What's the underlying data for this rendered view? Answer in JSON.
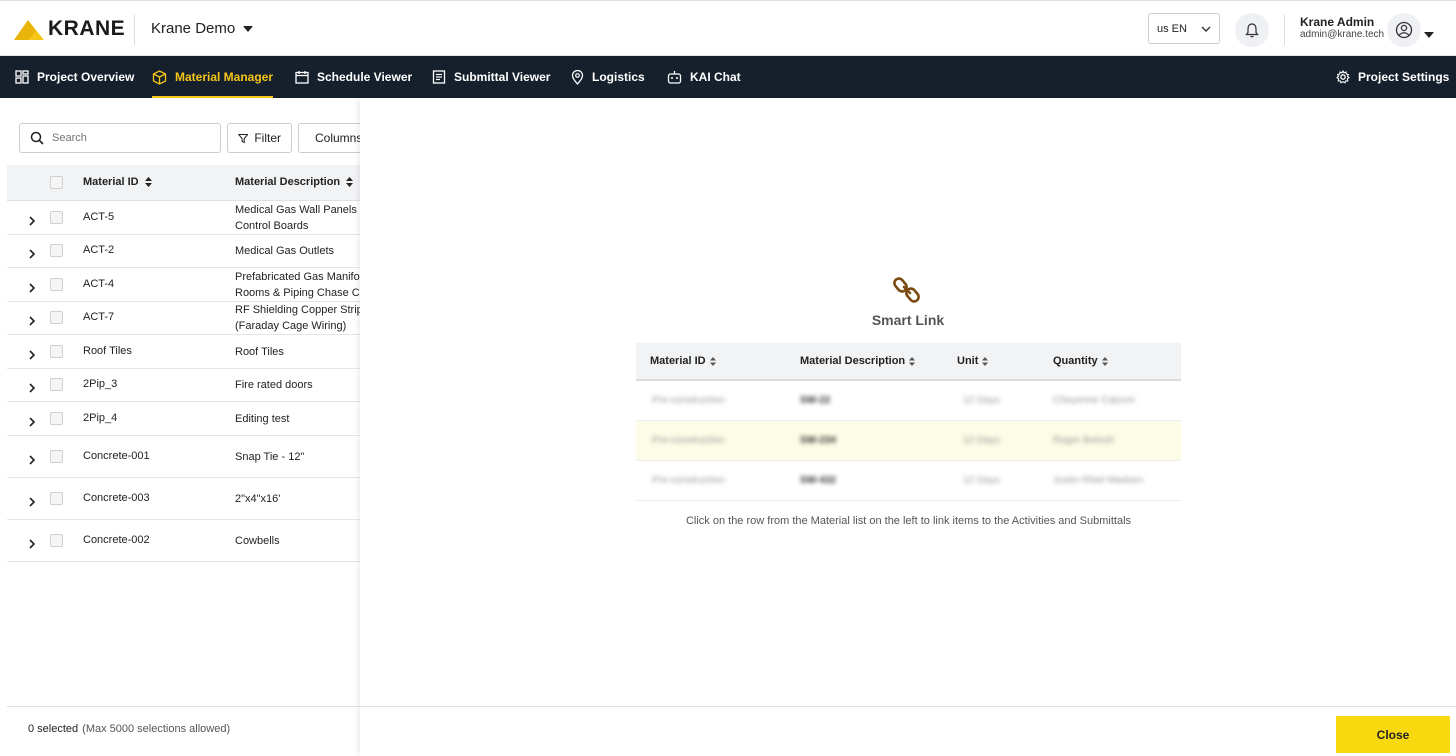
{
  "header": {
    "logo_text": "KRANE",
    "project_name": "Krane Demo",
    "language": "us EN",
    "user_name": "Krane Admin",
    "user_email": "admin@krane.tech",
    "brand_color": "#f5c518"
  },
  "nav": {
    "items": [
      {
        "label": "Project Overview",
        "icon": "grid-icon"
      },
      {
        "label": "Material Manager",
        "icon": "cube-icon",
        "active": true
      },
      {
        "label": "Schedule Viewer",
        "icon": "calendar-icon"
      },
      {
        "label": "Submittal Viewer",
        "icon": "document-icon"
      },
      {
        "label": "Logistics",
        "icon": "map-pin-icon"
      },
      {
        "label": "KAI Chat",
        "icon": "robot-icon"
      }
    ],
    "settings_label": "Project Settings"
  },
  "materials": {
    "search_placeholder": "Search",
    "filter_label": "Filter",
    "columns_label": "Columns",
    "headers": {
      "id": "Material ID",
      "description": "Material Description"
    },
    "rows": [
      {
        "id": "ACT-5",
        "description_lines": [
          "Medical Gas Wall Panels",
          "Control Boards"
        ]
      },
      {
        "id": "ACT-2",
        "description_lines": [
          "Medical Gas Outlets"
        ]
      },
      {
        "id": "ACT-4",
        "description_lines": [
          "Prefabricated Gas Manifold",
          "Rooms & Piping Chase Co"
        ]
      },
      {
        "id": "ACT-7",
        "description_lines": [
          "RF Shielding Copper Strip",
          "(Faraday Cage Wiring)"
        ]
      },
      {
        "id": "Roof Tiles",
        "description_lines": [
          "Roof Tiles"
        ]
      },
      {
        "id": "2Pip_3",
        "description_lines": [
          "Fire rated doors"
        ]
      },
      {
        "id": "2Pip_4",
        "description_lines": [
          "Editing test"
        ]
      },
      {
        "id": "Concrete-001",
        "description_lines": [
          "Snap Tie - 12\""
        ]
      },
      {
        "id": "Concrete-003",
        "description_lines": [
          "2\"x4\"x16'"
        ]
      },
      {
        "id": "Concrete-002",
        "description_lines": [
          "Cowbells"
        ]
      }
    ],
    "selected_text": "0 selected",
    "selection_limit_text": "(Max 5000 selections allowed)"
  },
  "smart_link": {
    "title": "Smart Link",
    "headers": {
      "id": "Material ID",
      "description": "Material Description",
      "unit": "Unit",
      "quantity": "Quantity"
    },
    "sample_rows": [
      {
        "id": "Pre-construction",
        "description": "SW-22",
        "unit": "12 Days",
        "quantity": "Cheyenne Calzoni"
      },
      {
        "id": "Pre-construction",
        "description": "SW-234",
        "unit": "12 Days",
        "quantity": "Roger Botosh",
        "highlighted": true
      },
      {
        "id": "Pre-construction",
        "description": "SW-432",
        "unit": "12 Days",
        "quantity": "Justin Rhiel Madsen"
      }
    ],
    "hint": "Click on the row from the Material list on the left to link items to the Activities and Submittals",
    "close_label": "Close",
    "close_color": "#f8d90f",
    "icon_color": "#7a4a12"
  }
}
